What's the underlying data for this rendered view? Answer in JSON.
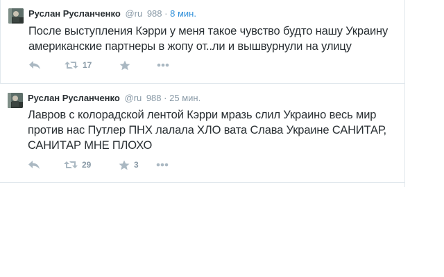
{
  "tweets": [
    {
      "author": "Руслан Русланченко",
      "handle": "@ru",
      "followers": "988",
      "separator": "·",
      "time": "8 мин.",
      "text": "После выступления Кэрри у меня такое чувство будто нашу Украину американские партнеры в жопу от..ли и вышвурнули на улицу",
      "retweets": "17",
      "favorites": ""
    },
    {
      "author": "Руслан Русланченко",
      "handle": "@ru",
      "followers": "988",
      "separator": "·",
      "time": "25 мин.",
      "text": "Лавров с колорадской лентой Кэрри мразь слил Украино весь мир против нас Путлер ПНХ лалала ХЛО вата Слава Украине САНИТАР, САНИТАР МНЕ ПЛОХО",
      "retweets": "29",
      "favorites": "3"
    }
  ],
  "icons": {
    "reply": "reply-icon",
    "retweet": "retweet-icon",
    "favorite": "star-icon",
    "more": "more-icon"
  },
  "colors": {
    "text": "#292f33",
    "muted": "#8899a6",
    "link": "#2f8fd9",
    "icon": "#aab8c2",
    "border": "#e1e8ed"
  }
}
